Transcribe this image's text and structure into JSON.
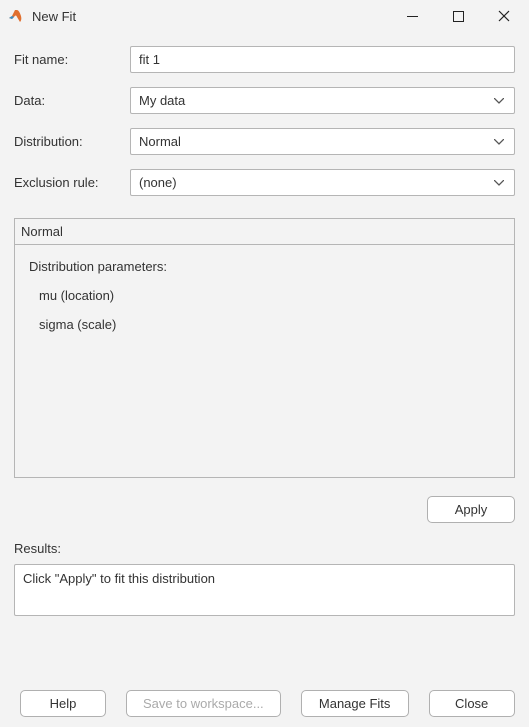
{
  "window": {
    "title": "New Fit"
  },
  "form": {
    "fitname": {
      "label": "Fit name:",
      "value": "fit 1"
    },
    "data": {
      "label": "Data:",
      "value": "My data"
    },
    "distribution": {
      "label": "Distribution:",
      "value": "Normal"
    },
    "exclusion": {
      "label": "Exclusion rule:",
      "value": "(none)"
    }
  },
  "panel": {
    "title": "Normal",
    "params_title": "Distribution parameters:",
    "params": [
      "mu (location)",
      "sigma (scale)"
    ]
  },
  "apply": {
    "label": "Apply"
  },
  "results": {
    "label": "Results:",
    "text": "Click \"Apply\" to fit this distribution"
  },
  "buttons": {
    "help": "Help",
    "save": "Save to workspace...",
    "manage": "Manage Fits",
    "close": "Close"
  }
}
